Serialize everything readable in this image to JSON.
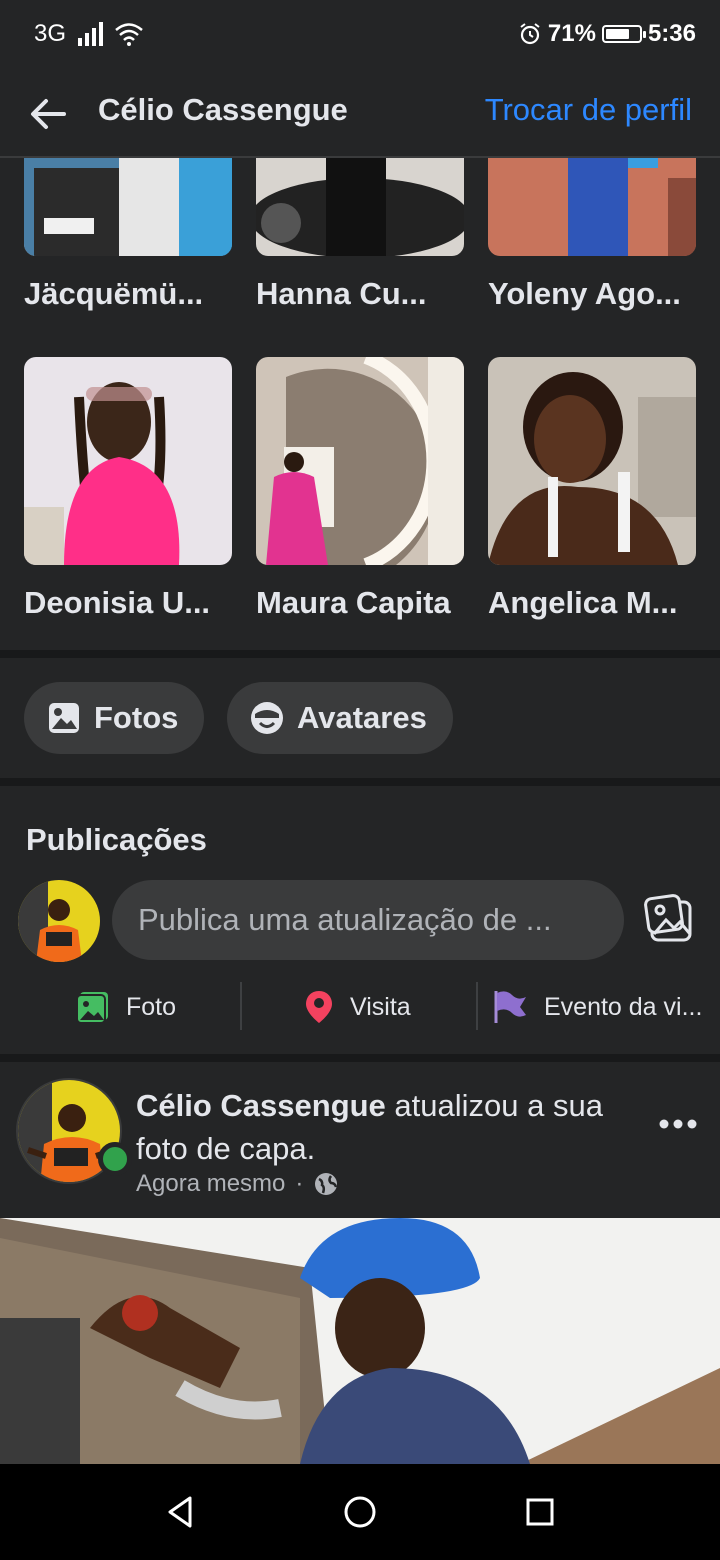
{
  "status_bar": {
    "network": "3G",
    "battery_percent": "71%",
    "battery_level": 0.71,
    "time": "5:36",
    "icons": [
      "signal-icon",
      "wifi-icon",
      "alarm-icon",
      "battery-icon"
    ]
  },
  "header": {
    "title": "Célio Cassengue",
    "action": "Trocar de perfil",
    "back_icon": "arrow-left-icon",
    "accent_color": "#2d88ff"
  },
  "friends": [
    {
      "name": "Jäcquëmü..."
    },
    {
      "name": "Hanna Cu..."
    },
    {
      "name": "Yoleny Ago..."
    },
    {
      "name": "Deonisia U..."
    },
    {
      "name": "Maura Capita"
    },
    {
      "name": "Angelica M..."
    }
  ],
  "pills": {
    "photos": "Fotos",
    "avatars": "Avatares"
  },
  "publications": {
    "title": "Publicações",
    "composer_placeholder": "Publica uma atualização de ...",
    "actions": {
      "photo": "Foto",
      "visit": "Visita",
      "event": "Evento da vi..."
    }
  },
  "post": {
    "author": "Célio Cassengue",
    "text": " atualizou a sua foto de capa.",
    "time": "Agora mesmo",
    "separator": "·",
    "visibility_icon": "globe-icon",
    "online_color": "#31a24c"
  },
  "nav": {
    "back": "nav-back-icon",
    "home": "nav-home-icon",
    "recents": "nav-recents-icon"
  }
}
